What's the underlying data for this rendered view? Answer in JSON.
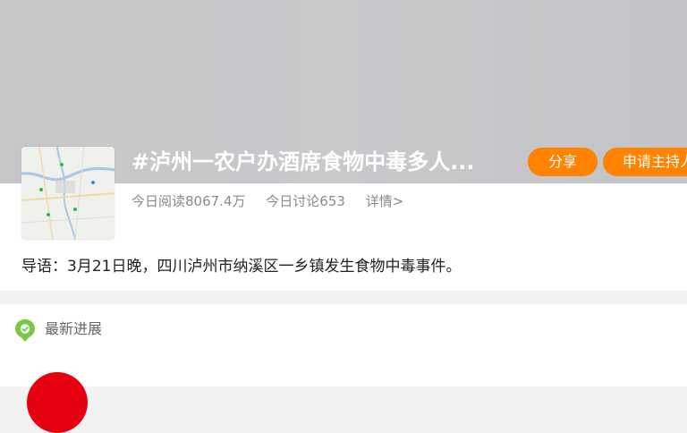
{
  "topic": {
    "title": "#泸州一农户办酒席食物中毒多人...",
    "share_label": "分享",
    "host_label": "申请主持人",
    "reads": "今日阅读8067.4万",
    "discussions": "今日讨论653",
    "details_link": "详情>",
    "lead": "导语：3月21日晚，四川泸州市纳溪区一乡镇发生食物中毒事件。"
  },
  "latest": {
    "title": "最新进展",
    "icon": "location-pin-icon"
  },
  "colors": {
    "accent": "#ff8200",
    "icon_green": "#7ac943",
    "avatar_red": "#e60012"
  }
}
